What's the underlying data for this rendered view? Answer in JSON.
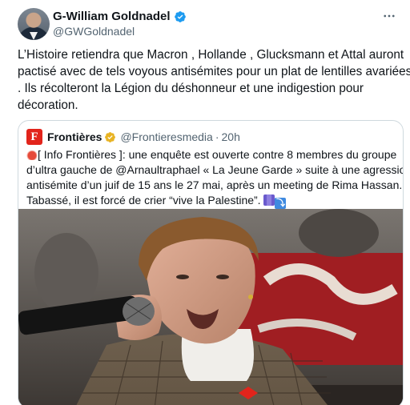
{
  "tweet": {
    "author_name": "G-William Goldnadel",
    "author_handle": "@GWGoldnadel",
    "text_lines": [
      "L’Histoire retiendra que Macron , Hollande , Glucksmann et Attal auront",
      "pactisé avec de tels voyous antisémites pour un plat de lentilles avariées",
      ". Ils récolteront la Légion du déshonneur et une indigestion pour",
      "décoration."
    ],
    "more_icon": "more-horizontal-icon",
    "verified_icon": "verified-badge-icon"
  },
  "quote": {
    "logo_letter": "F",
    "name": "Frontières",
    "handle": "@Frontieresmedia",
    "separator": "·",
    "time": "20h",
    "text_lines": [
      "[ Info Frontières ]: une enquête est ouverte contre 8 membres du groupe",
      "d’ultra gauche de @Arnaultraphael « La Jeune Garde » suite à une agression",
      "antisémite d’un juif de 15 ans le 27 mai, après un meeting de Rima Hassan.",
      "Tabassé, il est forcé de crier “vive la Palestine”."
    ],
    "image_alt": "photo-man-speaking-into-microphone"
  },
  "colors": {
    "text_primary": "#0f1419",
    "text_secondary": "#536471",
    "verified_blue": "#1d9bf0",
    "verified_gold": "#e8b323",
    "frontieres_red": "#e2241b",
    "border": "#cfd9de"
  }
}
